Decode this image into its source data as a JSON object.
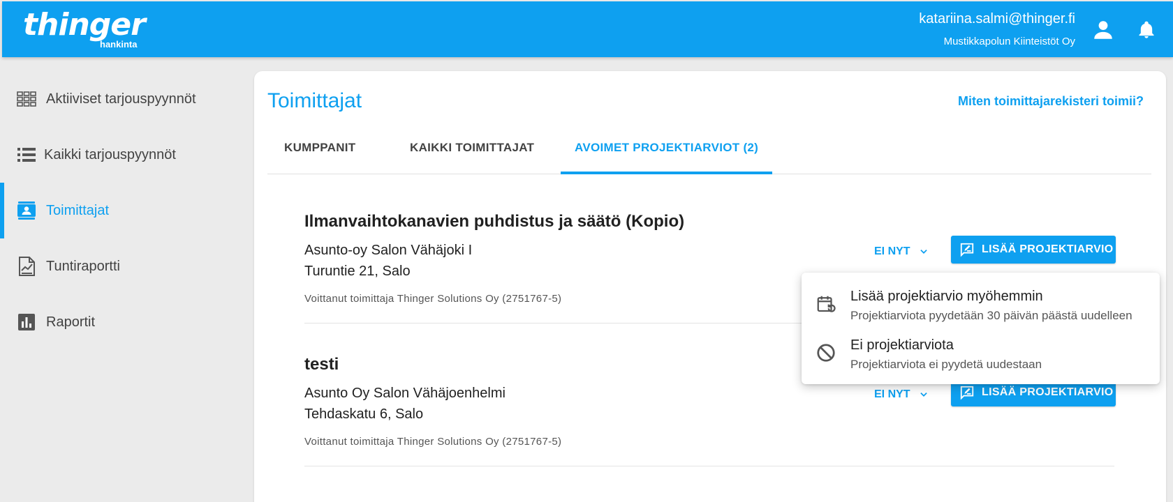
{
  "header": {
    "logo_text": "thinger",
    "logo_sub": "hankinta",
    "user_email": "katariina.salmi@thinger.fi",
    "organization": "Mustikkapolun Kiinteistöt Oy",
    "bg_color": "#0ea0f0"
  },
  "sidebar": {
    "items": [
      {
        "label": "Aktiiviset tarjouspyynnöt",
        "icon": "grid-icon",
        "active": false
      },
      {
        "label": "Kaikki tarjouspyynnöt",
        "icon": "list-icon",
        "active": false
      },
      {
        "label": "Toimittajat",
        "icon": "contact-card-icon",
        "active": true
      },
      {
        "label": "Tuntiraportti",
        "icon": "report-chart-icon",
        "active": false
      },
      {
        "label": "Raportit",
        "icon": "bar-chart-icon",
        "active": false
      }
    ]
  },
  "main": {
    "title": "Toimittajat",
    "help_link": "Miten toimittajarekisteri toimii?",
    "tabs": [
      {
        "label": "KUMPPANIT",
        "active": false
      },
      {
        "label": "KAIKKI TOIMITTAJAT",
        "active": false
      },
      {
        "label": "AVOIMET PROJEKTIARVIOT (2)",
        "active": true
      }
    ],
    "projects": [
      {
        "title": "Ilmanvaihtokanavien puhdistus ja säätö (Kopio)",
        "address_line1": "Asunto-oy Salon Vähäjoki I",
        "address_line2": "Turuntie 21, Salo",
        "winner": "Voittanut toimittaja Thinger Solutions Oy (2751767-5)",
        "dismiss_label": "EI NYT",
        "add_label": "LISÄÄ PROJEKTIARVIO"
      },
      {
        "title": "testi",
        "address_line1": "Asunto Oy Salon Vähäjoenhelmi",
        "address_line2": "Tehdaskatu 6, Salo",
        "winner": "Voittanut toimittaja Thinger Solutions Oy (2751767-5)",
        "dismiss_label": "EI NYT",
        "add_label": "LISÄÄ PROJEKTIARVIO"
      }
    ]
  },
  "dropdown_menu": {
    "items": [
      {
        "title": "Lisää projektiarvio myöhemmin",
        "subtitle": "Projektiarviota pyydetään 30 päivän päästä uudelleen",
        "icon": "calendar-refresh-icon"
      },
      {
        "title": "Ei projektiarviota",
        "subtitle": "Projektiarviota ei pyydetä uudestaan",
        "icon": "block-icon"
      }
    ]
  },
  "colors": {
    "accent": "#0ea0f0",
    "text": "#212121",
    "muted": "#555555"
  }
}
